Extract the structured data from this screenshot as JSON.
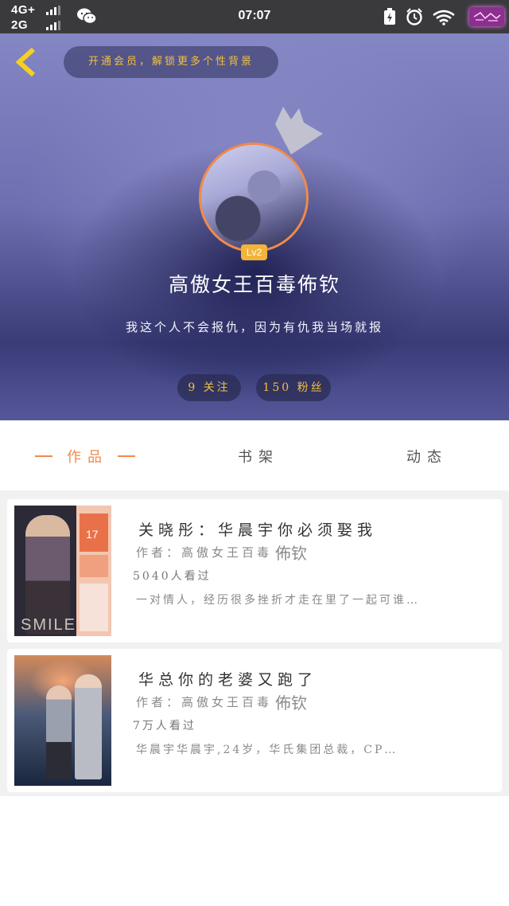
{
  "status_bar": {
    "network_1": "4G+",
    "network_2": "2G",
    "time": "07:07",
    "icons": [
      "signal-icon",
      "wechat-icon",
      "charging-icon",
      "alarm-icon",
      "wifi-icon",
      "battery-icon"
    ]
  },
  "header": {
    "notice": "开通会员，解锁更多个性背景",
    "level": "Lv2",
    "username": "高傲女王百毒佈钦",
    "bio": "我这个人不会报仇，因为有仇我当场就报",
    "follow_label": "9 关注",
    "fans_label": "150 粉丝"
  },
  "tabs": [
    {
      "label": "作品",
      "active": true
    },
    {
      "label": "书架",
      "active": false
    },
    {
      "label": "动态",
      "active": false
    }
  ],
  "works": [
    {
      "title": "关晓彤：华晨宇你必须娶我",
      "author_label": "作者：高傲女王百毒",
      "author_name": "佈钦",
      "views": "5040人看过",
      "description": "一对情人，经历很多挫折才走在里了一起可谁…",
      "cover_number": "17",
      "cover_text": "SMILE"
    },
    {
      "title": "华总你的老婆又跑了",
      "author_label": "作者：高傲女王百毒",
      "author_name": "佈钦",
      "views": "7万人看过",
      "description": "华晨宇华晨宇,24岁，华氏集团总裁，CP…"
    }
  ],
  "colors": {
    "accent": "#f08a4b",
    "gold": "#f0c040",
    "header_top": "#8586c4",
    "header_dark": "#2c2e64"
  }
}
